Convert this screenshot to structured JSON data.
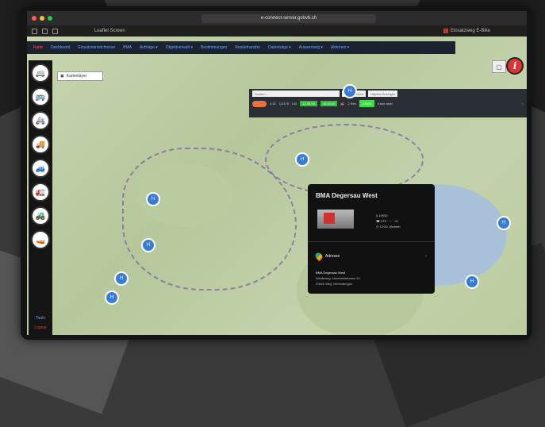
{
  "browser": {
    "url": "e-connect-server.gsbvb.ch",
    "tab1": "Leaflet Screen",
    "tab2": "Einsatzweg E-Bike"
  },
  "navbar": {
    "items": [
      "Karte",
      "Dashboard",
      "Einsatzverzeichnisse",
      "BMA",
      "Aufträge ▾",
      "Objektverwalt ▾",
      "Bestimmungen",
      "Rastertransfer",
      "Datenträge ▾",
      "Auswertung ▾",
      "Aktionen ▾"
    ]
  },
  "layer_button": {
    "label": "Kartenlayer"
  },
  "filter": {
    "search_placeholder": "Suchen...",
    "btn1": "Zurücksetzen",
    "btn2": "Objekte Anzeigen",
    "row": [
      "4.32",
      "12/179 · 100",
      "12.03.00",
      "15.00.00",
      "2 Res",
      "17500",
      "Karte aktiv"
    ]
  },
  "popup": {
    "title": "BMA Degersau West",
    "meta1": "§ 19930",
    "meta2": "☎ 079 · ··· · 11",
    "meta3": "◷ 12:00 | Betrieb",
    "addr_label": "Adresse",
    "addr1": "BMA Degersau West",
    "addr2": "Weideweg, Nordnetzstrasse 10",
    "addr3": "Zürich Weg Verbindungen"
  },
  "sidebar": {
    "icons": [
      "vehicle-icon",
      "vehicle-icon",
      "ambulance-icon",
      "truck-icon",
      "car-icon",
      "tanker-icon",
      "crane-icon",
      "boat-icon"
    ],
    "text1": "Tools",
    "text2": "Logout"
  },
  "pin_label": "H"
}
